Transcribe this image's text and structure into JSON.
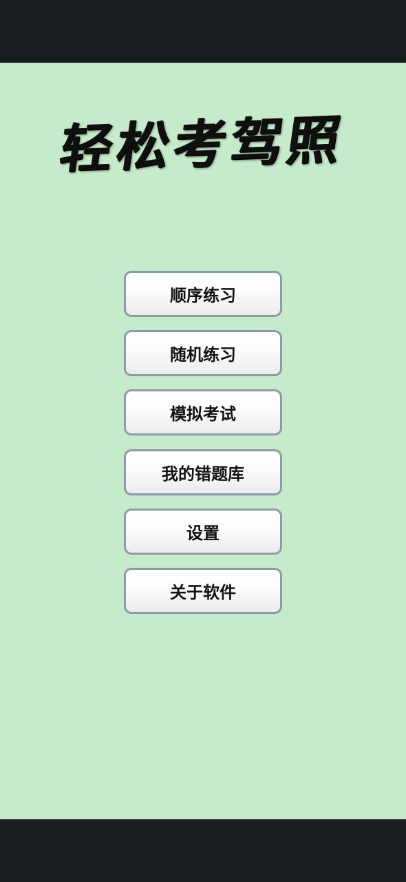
{
  "app": {
    "title": "轻松考驾照"
  },
  "menu": {
    "items": [
      {
        "label": "顺序练习"
      },
      {
        "label": "随机练习"
      },
      {
        "label": "模拟考试"
      },
      {
        "label": "我的错题库"
      },
      {
        "label": "设置"
      },
      {
        "label": "关于软件"
      }
    ]
  },
  "colors": {
    "background": "#c6ebca",
    "system_bars": "#191d21",
    "button_border": "#8d9aa7"
  }
}
